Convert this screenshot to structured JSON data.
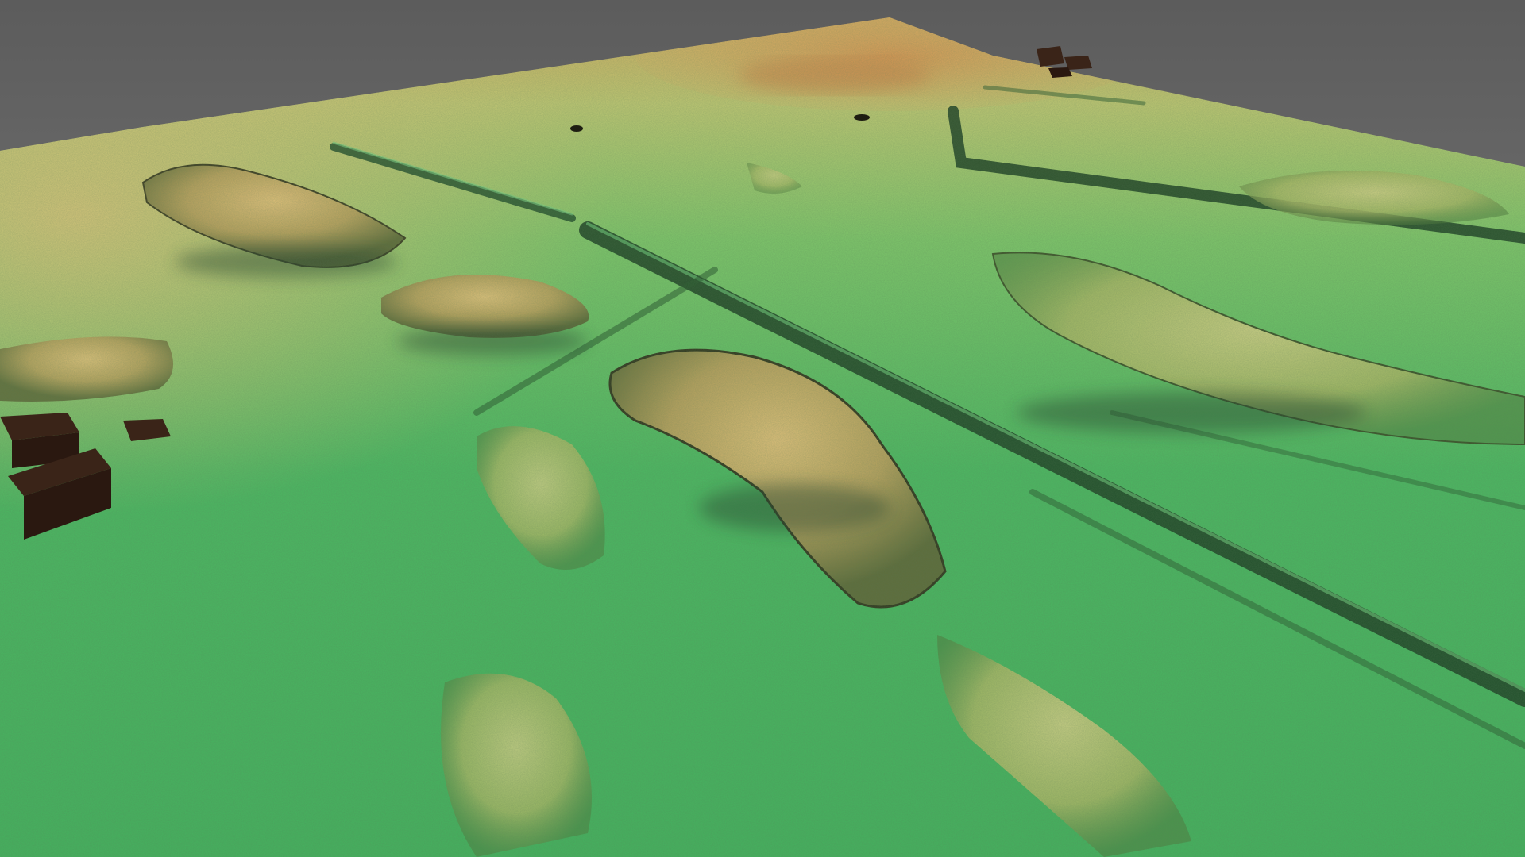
{
  "scene": {
    "colors": {
      "sky_top": "#5c5c5c",
      "sky_bottom": "#8c8c8c",
      "low": "#3fae5c",
      "mid": "#8fc66a",
      "high": "#d9b56a",
      "peak": "#c98a48",
      "shadow": "#2b4a2a",
      "structure": "#3a2418"
    }
  }
}
